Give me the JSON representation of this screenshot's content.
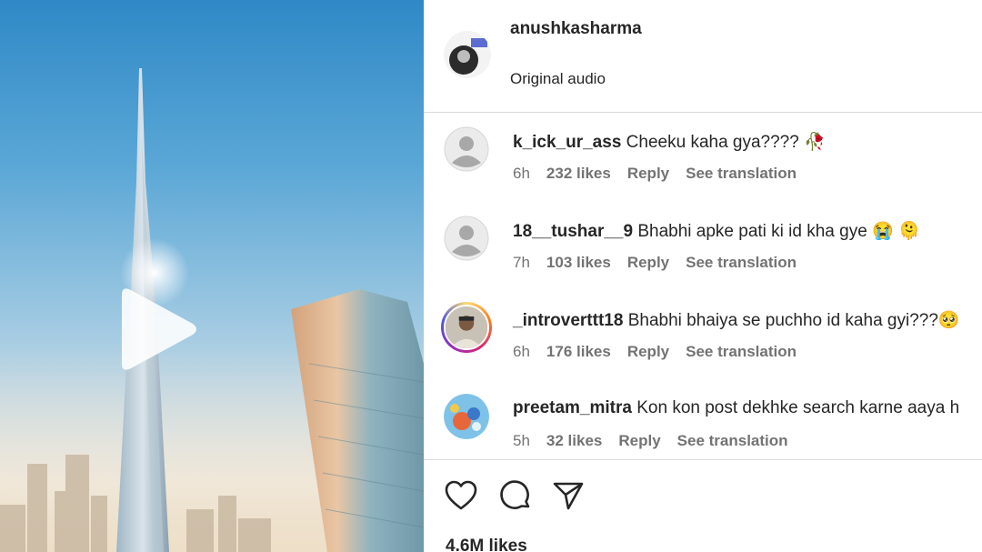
{
  "post": {
    "author": "anushkasharma",
    "audio": "Original audio",
    "likes": "4.6M likes"
  },
  "comments": [
    {
      "username": "k_ick_ur_ass",
      "text": "Cheeku kaha gya???? 🥀",
      "time": "6h",
      "likes": "232 likes",
      "reply": "Reply",
      "translate": "See translation",
      "avatar": "default-avatar"
    },
    {
      "username": "18__tushar__9",
      "text": "Bhabhi apke pati ki id kha gye 😭 🫠",
      "time": "7h",
      "likes": "103 likes",
      "reply": "Reply",
      "translate": "See translation",
      "avatar": "default-avatar"
    },
    {
      "username": "_introverttt18",
      "text": "Bhabhi bhaiya se puchho id kaha gyi???🥺",
      "time": "6h",
      "likes": "176 likes",
      "reply": "Reply",
      "translate": "See translation",
      "avatar": "photo-avatar-story"
    },
    {
      "username": "preetam_mitra",
      "text": "Kon kon post dekhke search karne aaya h",
      "time": "5h",
      "likes": "32 likes",
      "reply": "Reply",
      "translate": "See translation",
      "avatar": "cartoon-avatar"
    }
  ],
  "icons": {
    "play": "play-icon",
    "like": "heart-icon",
    "comment": "comment-bubble-icon",
    "share": "paper-plane-icon"
  },
  "colors": {
    "text": "#262626",
    "meta": "#737373",
    "divider": "#dbdbdb"
  }
}
